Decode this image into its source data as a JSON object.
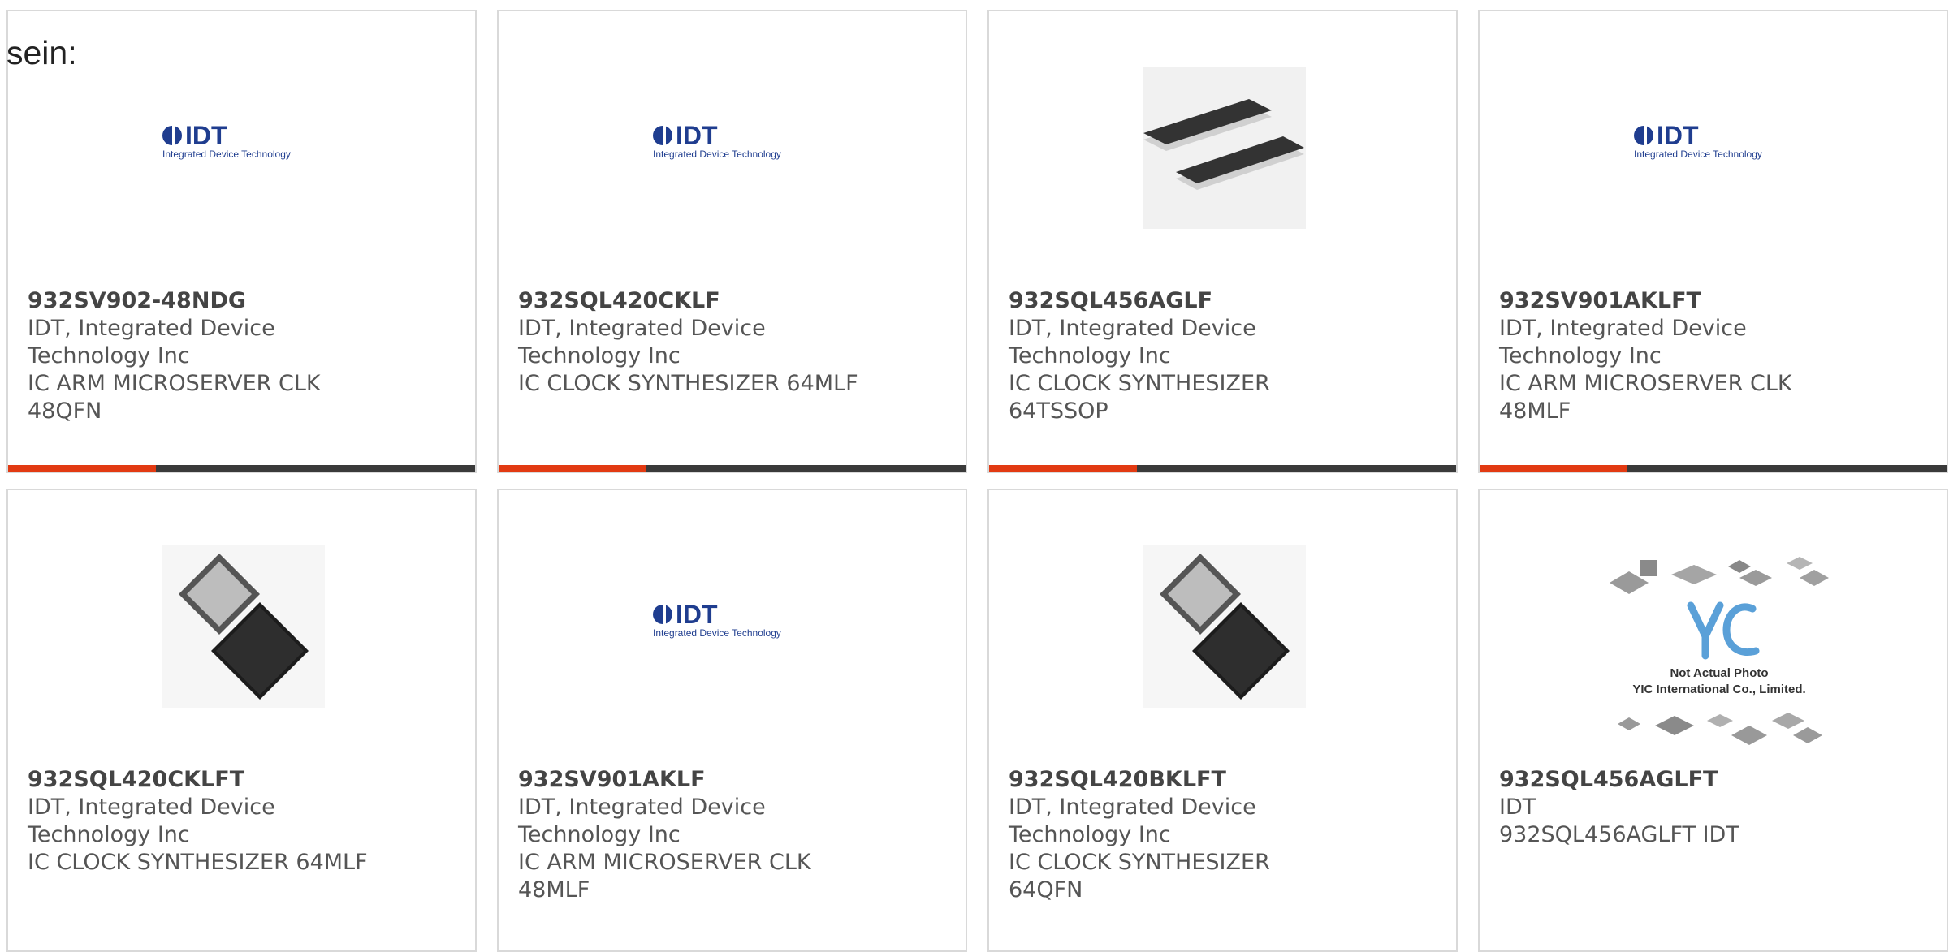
{
  "intro_text": "sein:",
  "brand_colors": {
    "accent": "#e23a12",
    "bar": "#3a3a3a",
    "logo_blue": "#1f3d8f"
  },
  "logo": {
    "word": "IDT",
    "tagline": "Integrated Device Technology"
  },
  "placeholder": {
    "brand": "YIC",
    "line1": "Not Actual Photo",
    "line2": "YIC International Co., Limited."
  },
  "cards": [
    {
      "part": "932SV902-48NDG",
      "mfr": "IDT, Integrated Device Technology Inc",
      "desc": "IC ARM MICROSERVER CLK 48QFN",
      "image": "idt-logo"
    },
    {
      "part": "932SQL420CKLF",
      "mfr": "IDT, Integrated Device Technology Inc",
      "desc": "IC CLOCK SYNTHESIZER 64MLF",
      "image": "idt-logo"
    },
    {
      "part": "932SQL456AGLF",
      "mfr": "IDT, Integrated Device Technology Inc",
      "desc": "IC CLOCK SYNTHESIZER 64TSSOP",
      "image": "tssop-chip"
    },
    {
      "part": "932SV901AKLFT",
      "mfr": "IDT, Integrated Device Technology Inc",
      "desc": "IC ARM MICROSERVER CLK 48MLF",
      "image": "idt-logo"
    },
    {
      "part": "932SQL420CKLFT",
      "mfr": "IDT, Integrated Device Technology Inc",
      "desc": "IC CLOCK SYNTHESIZER 64MLF",
      "image": "qfn-chip"
    },
    {
      "part": "932SV901AKLF",
      "mfr": "IDT, Integrated Device Technology Inc",
      "desc": "IC ARM MICROSERVER CLK 48MLF",
      "image": "idt-logo"
    },
    {
      "part": "932SQL420BKLFT",
      "mfr": "IDT, Integrated Device Technology Inc",
      "desc": "IC CLOCK SYNTHESIZER 64QFN",
      "image": "qfn-chip"
    },
    {
      "part": "932SQL456AGLFT",
      "mfr": "IDT",
      "desc": "932SQL456AGLFT IDT",
      "image": "yic-placeholder"
    }
  ]
}
